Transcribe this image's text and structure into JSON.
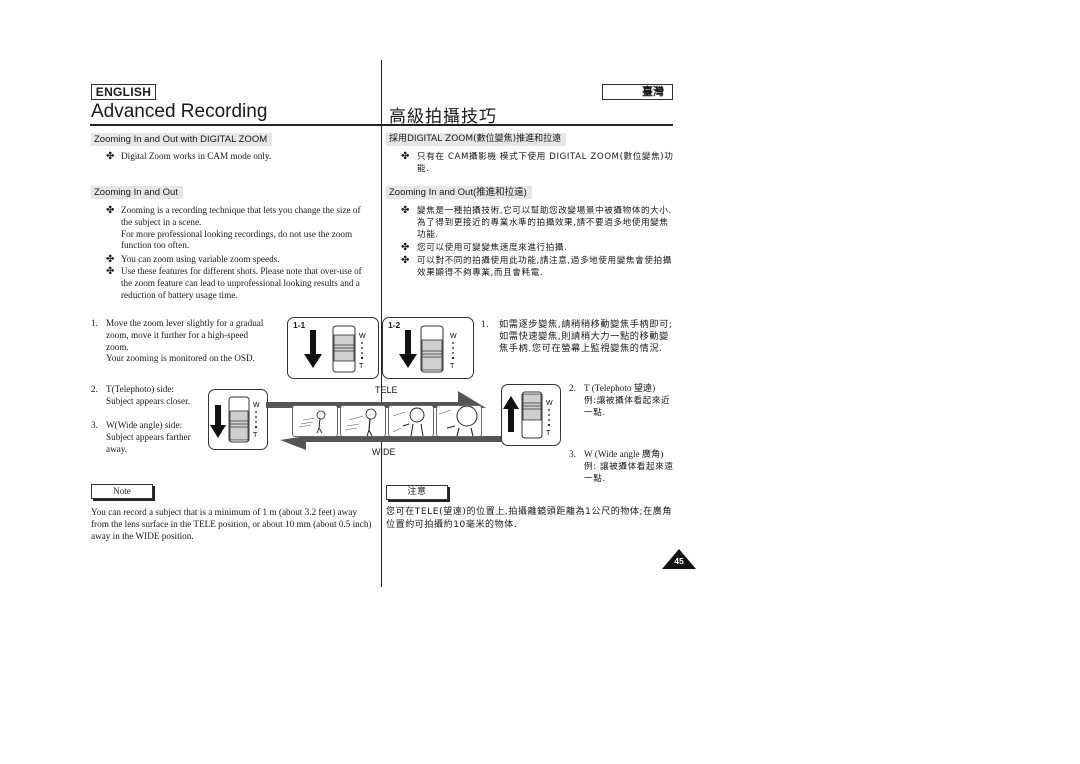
{
  "header": {
    "language_label": "ENGLISH",
    "region_label": "臺灣",
    "title_en": "Advanced Recording",
    "title_zh": "高級拍攝技巧"
  },
  "left": {
    "section1": {
      "heading": "Zooming In and Out with DIGITAL ZOOM",
      "bullets": [
        "Digital Zoom works in CAM mode only."
      ]
    },
    "section2": {
      "heading": "Zooming In and Out",
      "bullets": [
        "Zooming is a recording technique that lets you change the size of the subject in a scene.",
        "For more professional looking recordings, do not use the zoom function too often.",
        "You can zoom using variable zoom speeds.",
        "Use these features for different shots. Please note that over-use of the zoom feature can lead to unprofessional looking results and a reduction of battery usage time."
      ]
    },
    "steps": [
      {
        "num": "1.",
        "text": "Move the zoom lever slightly for a gradual zoom, move it further for a high-speed zoom.",
        "extra": "Your zooming is monitored on the OSD."
      },
      {
        "num": "2.",
        "text": "T(Telephoto) side:",
        "extra": "Subject appears closer."
      },
      {
        "num": "3.",
        "text": "W(Wide angle) side:",
        "extra": "Subject appears farther away."
      }
    ],
    "note": {
      "label": "Note",
      "text": "You can record a subject that is a minimum of 1 m (about 3.2 feet) away from the lens surface in the TELE position, or about 10 mm (about 0.5 inch) away in the WIDE position."
    }
  },
  "right": {
    "section1": {
      "heading": "採用DIGITAL ZOOM(數位變焦)推進和拉遠",
      "bullets": [
        "只有在 CAM攝影機 模式下使用 DIGITAL ZOOM(數位變焦)功能."
      ]
    },
    "section2": {
      "heading": "Zooming In and Out(推進和拉遠)",
      "bullets": [
        "變焦是一種拍攝技術,它可以幫助您改變場景中被攝物体的大小. 為了得到更接近的專業水準的拍攝效果,請不要過多地使用變焦功能.",
        "您可以使用可變變焦速度來進行拍攝.",
        "可以對不同的拍攝使用此功能,請注意,過多地使用變焦會使拍攝效果顯得不夠專業,而且會耗電."
      ]
    },
    "steps": [
      {
        "num": "1.",
        "text": "如需逐步變焦,請稍稍移動變焦手柄即可;如需快速變焦,則請稍大力一點的移動變焦手柄.您可在螢幕上監視變焦的情況."
      },
      {
        "num": "2.",
        "text": "T (Telephoto 望遠)",
        "extra": "例:讓被攝体看起來近一點."
      },
      {
        "num": "3.",
        "text": "W (Wide angle 廣角)",
        "extra": "例: 讓被攝体看起來遠一點."
      }
    ],
    "note": {
      "label": "注意",
      "text": "您可在TELE(望遠)的位置上,拍攝離鏡頭距離為1公尺的物体;在廣角位置約可拍攝約10毫米的物体."
    }
  },
  "diagram": {
    "lever1_label": "1-1",
    "lever2_label": "1-2",
    "w_mark": "W",
    "t_mark": "T",
    "tele_label": "TELE",
    "wide_label": "WIDE",
    "thumbnail_count": 4
  },
  "footer": {
    "page_number": "45"
  }
}
